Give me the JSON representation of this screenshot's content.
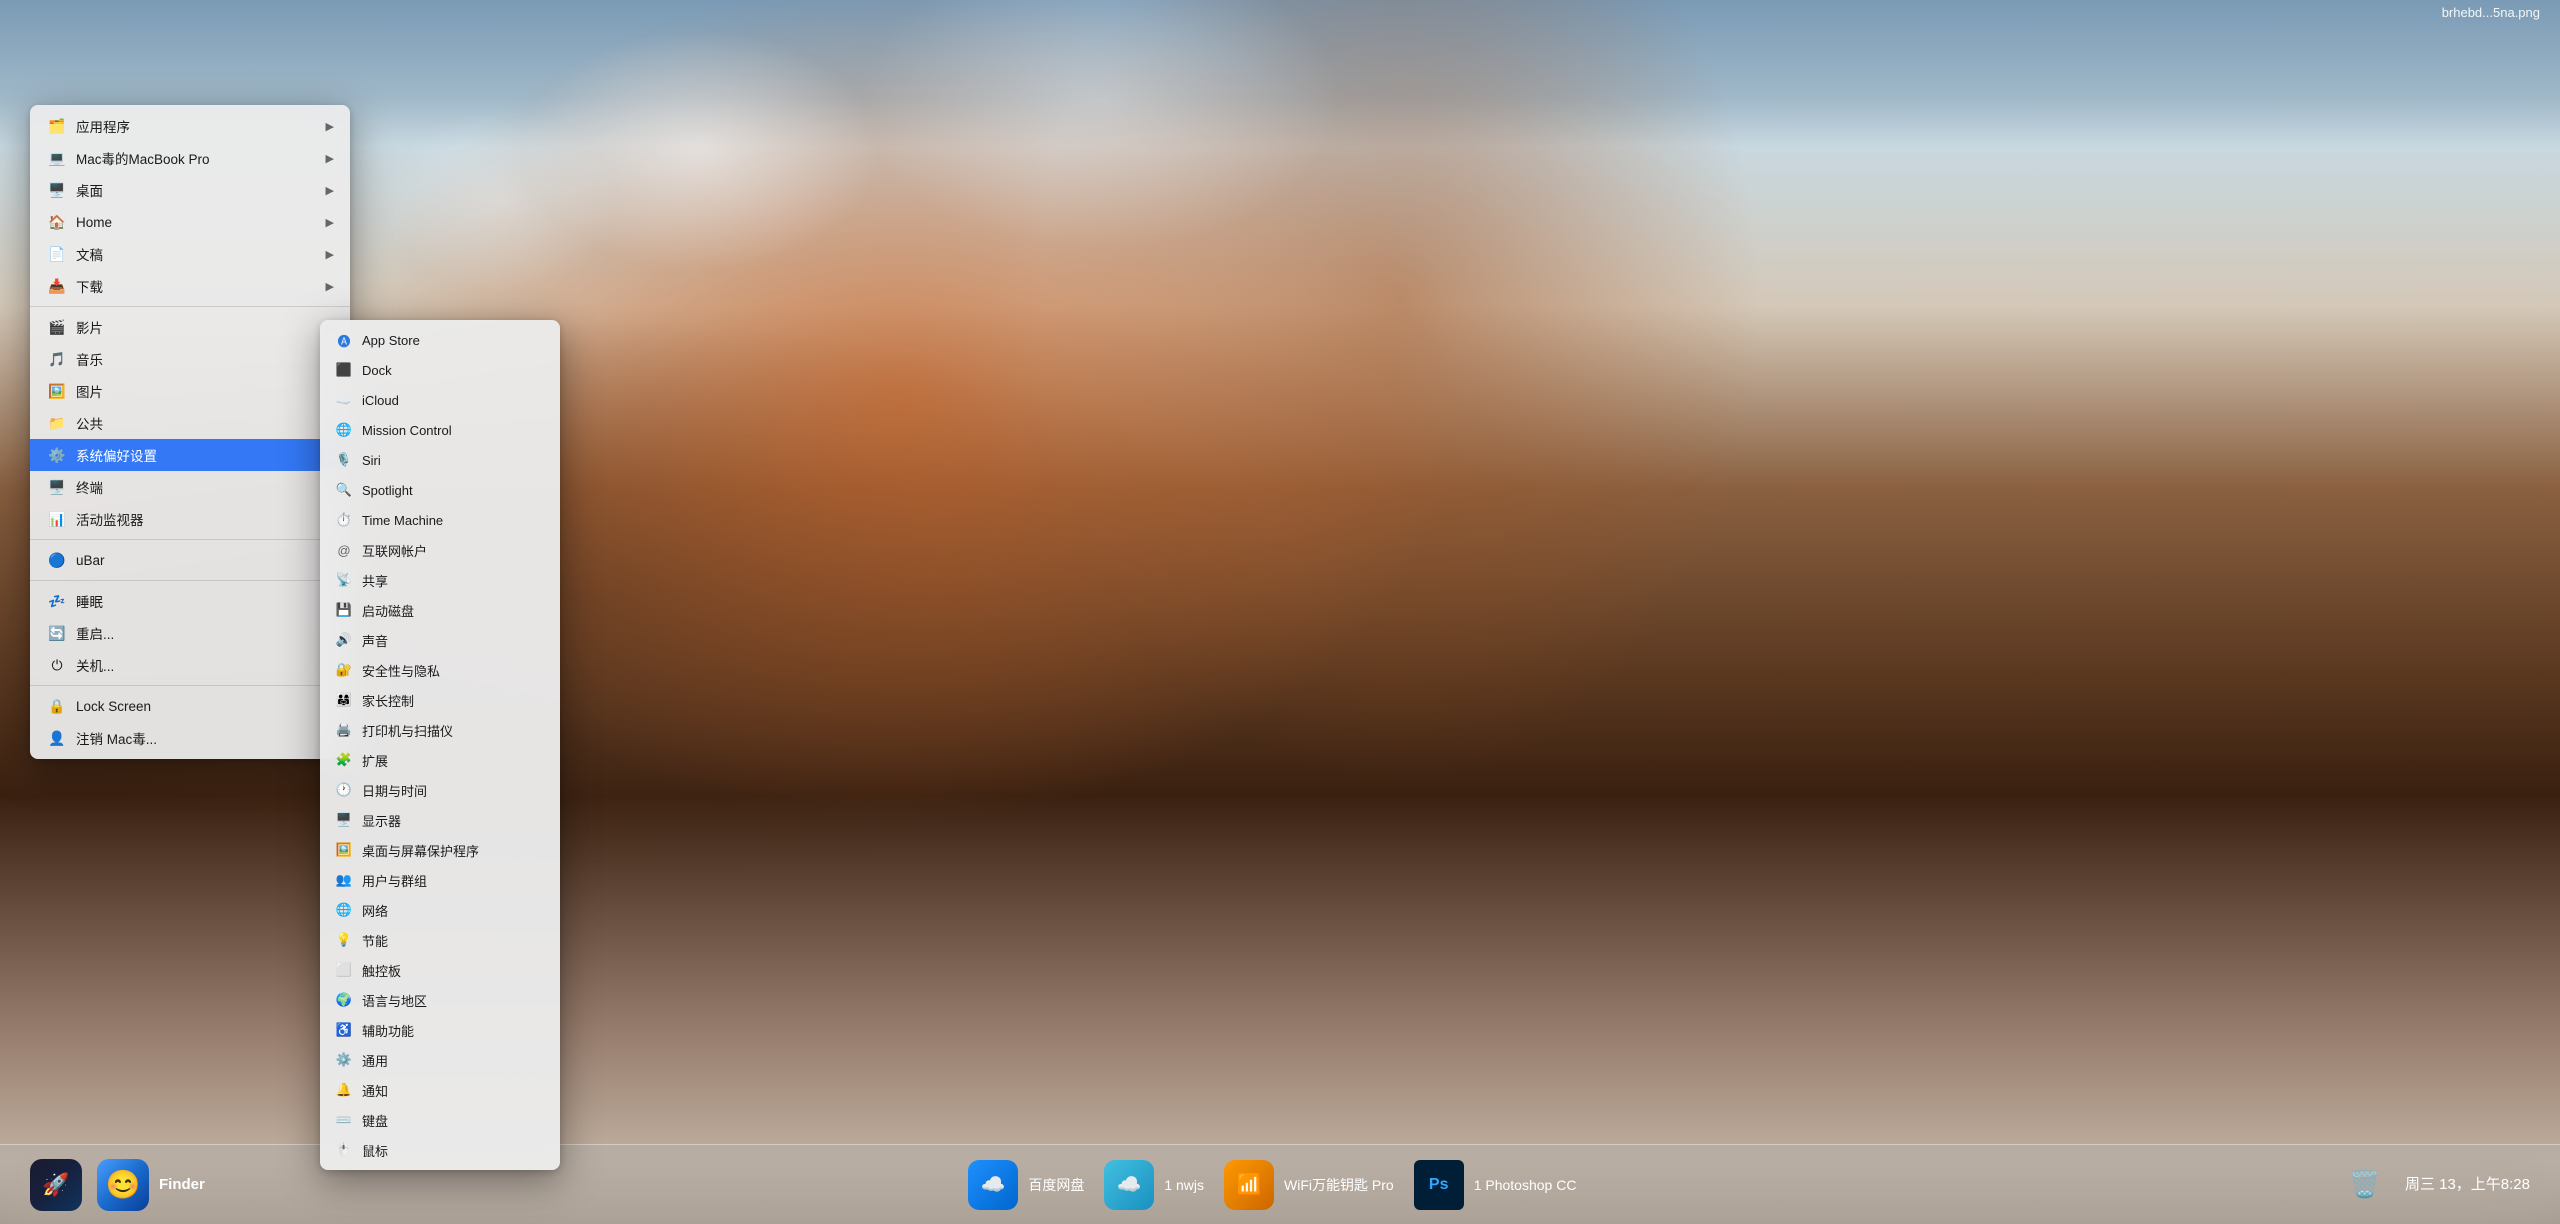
{
  "desktop": {
    "filename": "brhebd...5na.png"
  },
  "apple_menu": {
    "items": [
      {
        "id": "applications",
        "icon": "🗂️",
        "label": "应用程序",
        "hasArrow": true,
        "indent": false
      },
      {
        "id": "macbook",
        "icon": "💻",
        "label": "Mac毒的MacBook Pro",
        "hasArrow": true,
        "indent": false
      },
      {
        "id": "desktop",
        "icon": "🖥️",
        "label": "桌面",
        "hasArrow": true,
        "indent": false
      },
      {
        "id": "home",
        "icon": "🏠",
        "label": "Home",
        "hasArrow": true,
        "indent": false
      },
      {
        "id": "documents",
        "icon": "📄",
        "label": "文稿",
        "hasArrow": true,
        "indent": false
      },
      {
        "id": "downloads",
        "icon": "📥",
        "label": "下载",
        "hasArrow": true,
        "indent": false
      },
      {
        "id": "sep1",
        "type": "separator"
      },
      {
        "id": "movies",
        "icon": "🎬",
        "label": "影片",
        "hasArrow": true,
        "indent": false
      },
      {
        "id": "music",
        "icon": "🎵",
        "label": "音乐",
        "hasArrow": true,
        "indent": false
      },
      {
        "id": "pictures",
        "icon": "🖼️",
        "label": "图片",
        "hasArrow": true,
        "indent": false
      },
      {
        "id": "public",
        "icon": "📁",
        "label": "公共",
        "hasArrow": true,
        "indent": false
      },
      {
        "id": "syspref",
        "icon": "⚙️",
        "label": "系统偏好设置",
        "hasArrow": true,
        "highlighted": true,
        "indent": false
      },
      {
        "id": "terminal",
        "icon": "🖥️",
        "label": "终端",
        "hasArrow": false,
        "indent": false
      },
      {
        "id": "activity",
        "icon": "📊",
        "label": "活动监视器",
        "hasArrow": false,
        "indent": false
      },
      {
        "id": "sep2",
        "type": "separator"
      },
      {
        "id": "ubar",
        "icon": "🔵",
        "label": "uBar",
        "hasArrow": true,
        "indent": false
      },
      {
        "id": "sep3",
        "type": "separator"
      },
      {
        "id": "sleep",
        "icon": "💤",
        "label": "睡眠",
        "hasArrow": false,
        "indent": false
      },
      {
        "id": "restart",
        "icon": "🔄",
        "label": "重启...",
        "hasArrow": false,
        "indent": false
      },
      {
        "id": "shutdown",
        "icon": "⏻",
        "label": "关机...",
        "hasArrow": false,
        "indent": false
      },
      {
        "id": "sep4",
        "type": "separator"
      },
      {
        "id": "lockscreen",
        "icon": "🔒",
        "label": "Lock Screen",
        "hasArrow": false,
        "indent": false
      },
      {
        "id": "logout",
        "icon": "👤",
        "label": "注销 Mac毒...",
        "hasArrow": false,
        "indent": false
      }
    ]
  },
  "syspref_submenu": {
    "items": [
      {
        "id": "appstore",
        "icon": "🅐",
        "label": "App Store",
        "color": "blue"
      },
      {
        "id": "dock",
        "icon": "⬜",
        "label": "Dock",
        "color": "gray"
      },
      {
        "id": "icloud",
        "icon": "☁️",
        "label": "iCloud",
        "color": "blue"
      },
      {
        "id": "missioncontrol",
        "icon": "🌐",
        "label": "Mission Control",
        "color": "purple"
      },
      {
        "id": "siri",
        "icon": "🎙️",
        "label": "Siri",
        "color": "blue"
      },
      {
        "id": "spotlight",
        "icon": "🔍",
        "label": "Spotlight",
        "color": "blue"
      },
      {
        "id": "timemachine",
        "icon": "⏱️",
        "label": "Time Machine",
        "color": "gray"
      },
      {
        "id": "internetaccounts",
        "icon": "@",
        "label": "互联网帐户",
        "color": "gray"
      },
      {
        "id": "sharing",
        "icon": "📡",
        "label": "共享",
        "color": "orange"
      },
      {
        "id": "startupdisk",
        "icon": "💾",
        "label": "启动磁盘",
        "color": "gray"
      },
      {
        "id": "sound",
        "icon": "🔊",
        "label": "声音",
        "color": "gray"
      },
      {
        "id": "security",
        "icon": "🔐",
        "label": "安全性与隐私",
        "color": "gray"
      },
      {
        "id": "parental",
        "icon": "👨‍👩‍👧",
        "label": "家长控制",
        "color": "orange"
      },
      {
        "id": "printers",
        "icon": "🖨️",
        "label": "打印机与扫描仪",
        "color": "gray"
      },
      {
        "id": "extensions",
        "icon": "🧩",
        "label": "扩展",
        "color": "gray"
      },
      {
        "id": "datetime",
        "icon": "🕐",
        "label": "日期与时间",
        "color": "gray"
      },
      {
        "id": "displays",
        "icon": "🖥️",
        "label": "显示器",
        "color": "gray"
      },
      {
        "id": "desktopscreen",
        "icon": "🖼️",
        "label": "桌面与屏幕保护程序",
        "color": "gray"
      },
      {
        "id": "usersgroups",
        "icon": "👥",
        "label": "用户与群组",
        "color": "gray"
      },
      {
        "id": "network",
        "icon": "🌐",
        "label": "网络",
        "color": "blue"
      },
      {
        "id": "energy",
        "icon": "💡",
        "label": "节能",
        "color": "yellow"
      },
      {
        "id": "trackpad",
        "icon": "⬜",
        "label": "触控板",
        "color": "gray"
      },
      {
        "id": "language",
        "icon": "🌍",
        "label": "语言与地区",
        "color": "blue"
      },
      {
        "id": "accessibility",
        "icon": "♿",
        "label": "辅助功能",
        "color": "blue"
      },
      {
        "id": "general",
        "icon": "⚙️",
        "label": "通用",
        "color": "gray"
      },
      {
        "id": "notifications",
        "icon": "🔔",
        "label": "通知",
        "color": "gray"
      },
      {
        "id": "keyboard",
        "icon": "⌨️",
        "label": "键盘",
        "color": "gray"
      },
      {
        "id": "mouse",
        "icon": "🖱️",
        "label": "鼠标",
        "color": "gray"
      }
    ]
  },
  "bottom_bar": {
    "left_items": [
      {
        "id": "launchpad",
        "icon": "🚀",
        "label": ""
      },
      {
        "id": "finder",
        "icon": "😊",
        "label": "Finder",
        "highlighted": true
      }
    ],
    "center_apps": [
      {
        "id": "baidu",
        "icon": "☁️",
        "label": "百度网盘"
      },
      {
        "id": "nwjs",
        "icon": "☁️",
        "label": "1 nwjs"
      },
      {
        "id": "wifi",
        "icon": "📶",
        "label": "WiFi万能钥匙 Pro"
      },
      {
        "id": "photoshop",
        "icon": "Ps",
        "label": "1 Photoshop CC"
      }
    ],
    "trash": "🗑️",
    "time": "周三 13，上午8:28"
  }
}
